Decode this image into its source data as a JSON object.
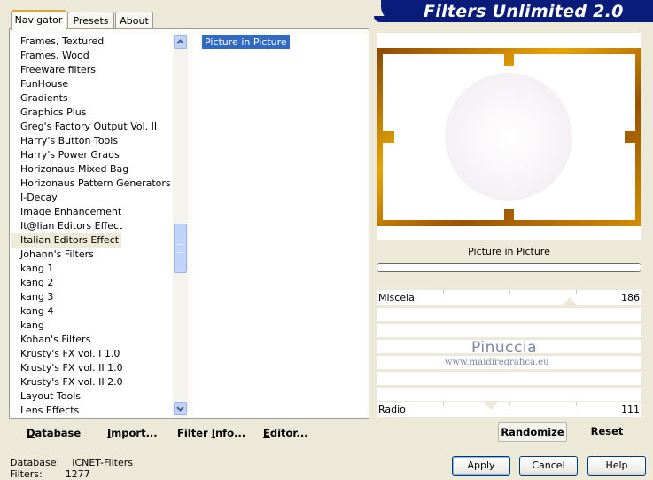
{
  "app": {
    "title": "Filters Unlimited 2.0"
  },
  "tabs": [
    {
      "label": "Navigator",
      "active": true
    },
    {
      "label": "Presets",
      "active": false
    },
    {
      "label": "About",
      "active": false
    }
  ],
  "categories": [
    "Frames, Textured",
    "Frames, Wood",
    "Freeware filters",
    "FunHouse",
    "Gradients",
    "Graphics Plus",
    "Greg's Factory Output Vol. II",
    "Harry's Button Tools",
    "Harry's Power Grads",
    "Horizonaus Mixed Bag",
    "Horizonaus Pattern Generators",
    "I-Decay",
    "Image Enhancement",
    "It@lian Editors Effect",
    "Italian Editors Effect",
    "Johann's Filters",
    "kang 1",
    "kang 2",
    "kang 3",
    "kang 4",
    "kang",
    "Kohan's Filters",
    "Krusty's FX vol. I 1.0",
    "Krusty's FX vol. II 1.0",
    "Krusty's FX vol. II 2.0",
    "Layout Tools",
    "Lens Effects"
  ],
  "selected_category": "Italian Editors Effect",
  "filters": [
    "Picture in Picture"
  ],
  "selected_filter": "Picture in Picture",
  "toolbar": {
    "database": {
      "pre": "",
      "u": "D",
      "post": "atabase"
    },
    "import": {
      "pre": "",
      "u": "I",
      "post": "mport..."
    },
    "filter_info": {
      "pre": "Filter ",
      "u": "I",
      "post": "nfo..."
    },
    "editor": {
      "pre": "",
      "u": "E",
      "post": "ditor..."
    }
  },
  "preview": {
    "filter_name": "Picture in Picture",
    "frame_color": "#b56a00",
    "progress": 0
  },
  "sliders": [
    {
      "label": "Miscela",
      "value": "186"
    },
    {
      "label": "Radio",
      "value": "111"
    }
  ],
  "watermark": {
    "name": "Pinuccia",
    "url": "www.maidiregrafica.eu"
  },
  "buttons": {
    "randomize": "Randomize",
    "reset": "Reset",
    "apply": "Apply",
    "cancel": "Cancel",
    "help": "Help"
  },
  "status": {
    "database_label": "Database:",
    "database_value": "ICNET-Filters",
    "filters_label": "Filters:",
    "filters_value": "1277"
  },
  "colors": {
    "banner": "#0a1c7a",
    "selection": "#316ac5",
    "scroll": "#c2d3fc",
    "dialog_bg": "#ece9d8"
  }
}
